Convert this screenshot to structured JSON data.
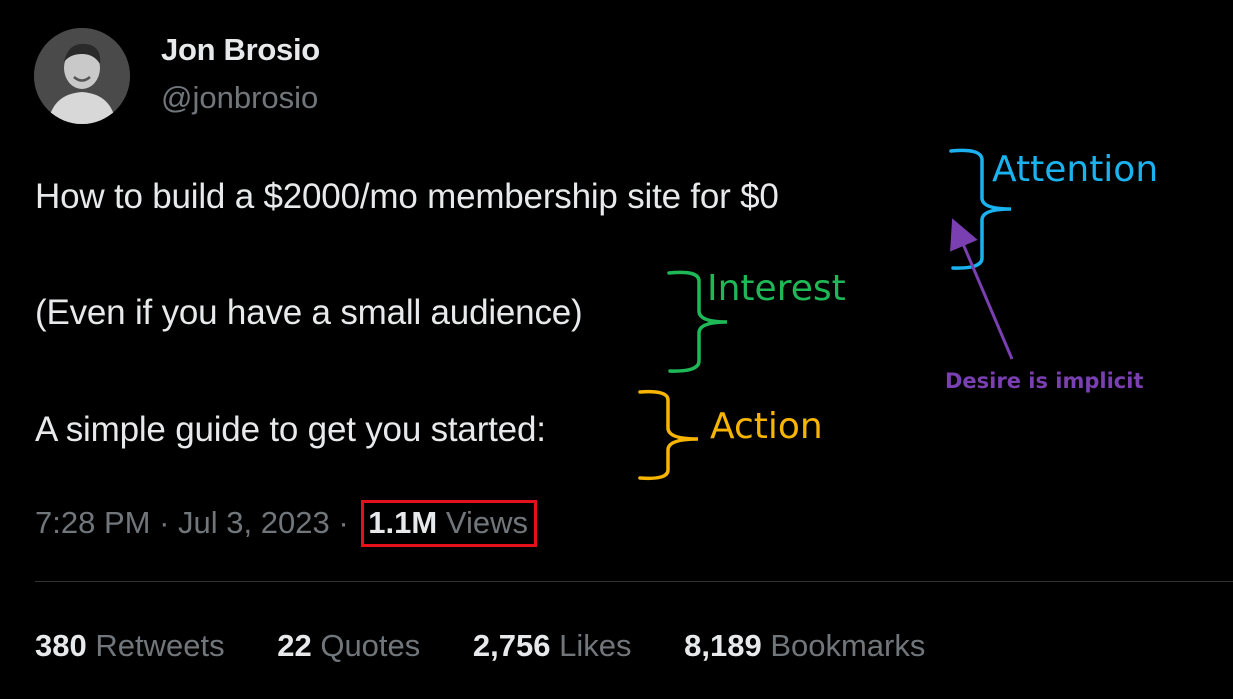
{
  "author": {
    "display_name": "Jon Brosio",
    "handle": "@jonbrosio",
    "avatar_icon": "person-photo-icon"
  },
  "tweet": {
    "lines": [
      "How to build a $2000/mo membership site for $0",
      "(Even if you have a small audience)",
      "A simple guide to get you started:"
    ]
  },
  "annotations": {
    "attention": {
      "label": "Attention",
      "color": "#1ab3f0"
    },
    "interest": {
      "label": "Interest",
      "color": "#1fb857"
    },
    "action": {
      "label": "Action",
      "color": "#f7b500"
    },
    "desire": {
      "label": "Desire is implicit",
      "color": "#7a3fb0"
    }
  },
  "meta": {
    "time": "7:28 PM",
    "separator": "·",
    "date": "Jul 3, 2023",
    "views_count": "1.1M",
    "views_label": "Views",
    "highlight_color": "#e4101b"
  },
  "stats": [
    {
      "count": "380",
      "label": "Retweets"
    },
    {
      "count": "22",
      "label": "Quotes"
    },
    {
      "count": "2,756",
      "label": "Likes"
    },
    {
      "count": "8,189",
      "label": "Bookmarks"
    }
  ]
}
